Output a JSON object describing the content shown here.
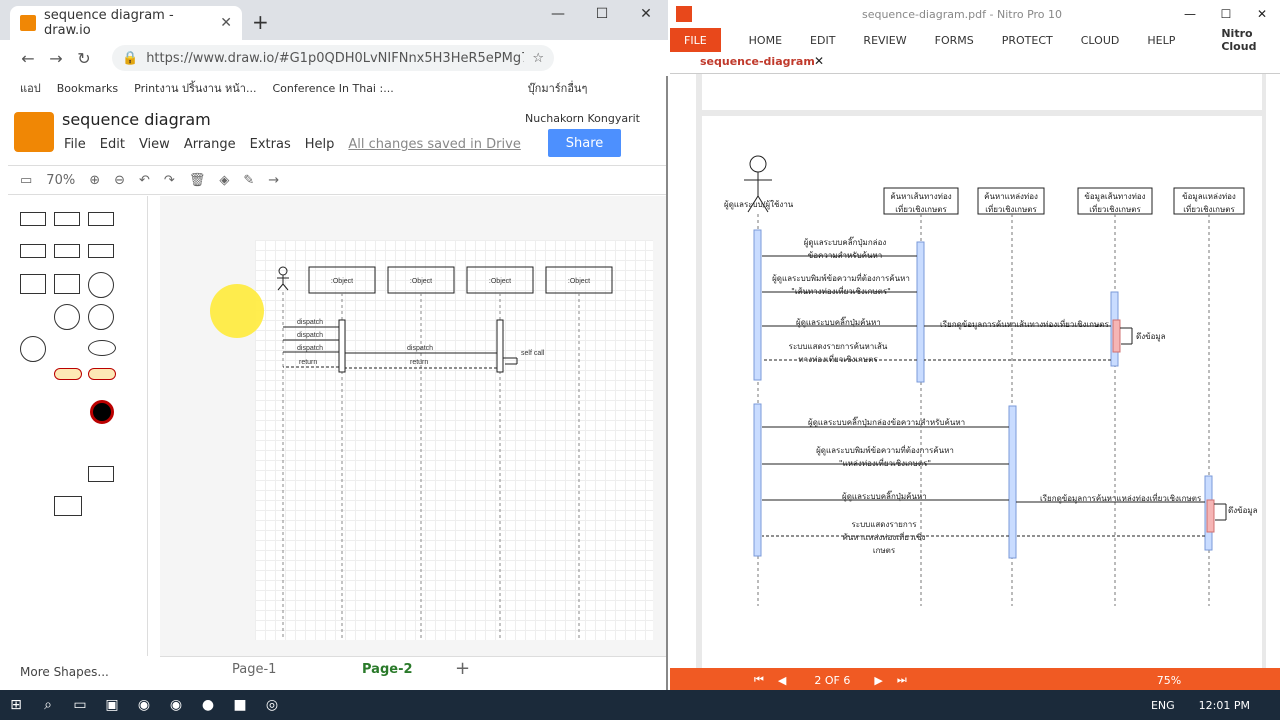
{
  "chrome": {
    "tab_title": "sequence diagram - draw.io",
    "url": "https://www.draw.io/#G1p0QDH0LvNIFNnx5H3HeR5ePMg7F_...",
    "bookmarks": [
      "แอป",
      "Bookmarks",
      "Printงาน ปริ้นงาน หน้า...",
      "Conference In Thai :...",
      "บุ๊กมาร์กอื่นๆ"
    ]
  },
  "drawio": {
    "title": "sequence diagram",
    "menu": [
      "File",
      "Edit",
      "View",
      "Arrange",
      "Extras",
      "Help"
    ],
    "saved": "All changes saved in Drive",
    "user": "Nuchakorn Kongyarit",
    "share": "Share",
    "zoom": "70%",
    "more_shapes": "More Shapes...",
    "pages": [
      "Page-1",
      "Page-2"
    ],
    "objects": [
      ":Object",
      ":Object",
      ":Object",
      ":Object"
    ],
    "messages": [
      "dispatch",
      "dispatch",
      "dispatch",
      "return",
      "dispatch",
      "return",
      "self call"
    ]
  },
  "nitro": {
    "title": "sequence-diagram.pdf - Nitro Pro 10",
    "ribbon": [
      "FILE",
      "HOME",
      "EDIT",
      "REVIEW",
      "FORMS",
      "PROTECT",
      "CLOUD",
      "HELP"
    ],
    "cloud": "Nitro Cloud",
    "doc_tab": "sequence-diagram",
    "page_indicator": "2 OF 6",
    "zoom": "75%",
    "actor": "ผู้ดูแลระบบ/ผู้ใช้งาน",
    "lifelines": [
      "ค้นหาเส้นทางท่องเที่ยวเชิงเกษตร",
      "ค้นหาแหล่งท่องเที่ยวเชิงเกษตร",
      "ข้อมูลเส้นทางท่องเที่ยวเชิงเกษตร",
      "ข้อมูลแหล่งท่องเที่ยวเชิงเกษตร"
    ],
    "msgs": [
      "ผู้ดูแลระบบคลิ๊กปุ่มกล่องข้อความสำหรับค้นหา",
      "ผู้ดูแลระบบพิมพ์ข้อความที่ต้องการค้นหา \"เส้นทางท่องเที่ยวเชิงเกษตร\"",
      "ผู้ดูแลระบบคลิ๊กปุ่มค้นหา",
      "เรียกดูข้อมูลการค้นหาเส้นทางท่องเที่ยวเชิงเกษตร",
      "ดึงข้อมูล",
      "ระบบแสดงรายการค้นหาเส้นทางท่องเที่ยวเชิงเกษตร",
      "ผู้ดูแลระบบคลิ๊กปุ่มกล่องข้อความสำหรับค้นหา",
      "ผู้ดูแลระบบพิมพ์ข้อความที่ต้องการค้นหา \"แหล่งท่องเที่ยวเชิงเกษตร\"",
      "ผู้ดูแลระบบคลิ๊กปุ่มค้นหา",
      "เรียกดูข้อมูลการค้นหาแหล่งท่องเที่ยวเชิงเกษตร",
      "ดึงข้อมูล",
      "ระบบแสดงรายการค้นหาแหล่งท่องเที่ยวเชิงเกษตร"
    ]
  },
  "taskbar": {
    "lang": "ENG",
    "time": "12:01 PM"
  }
}
